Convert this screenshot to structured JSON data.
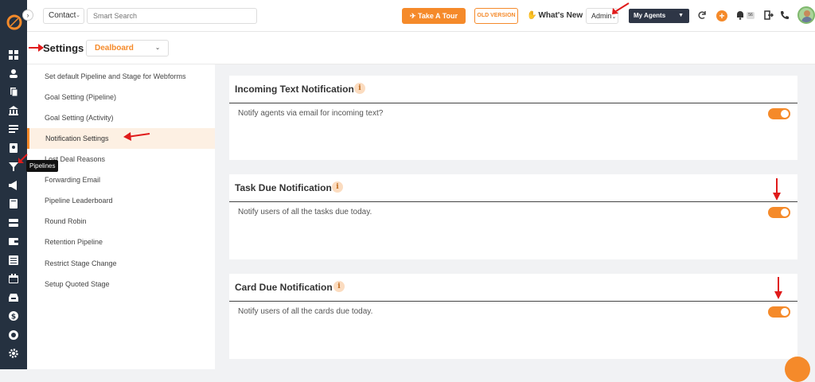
{
  "topbar": {
    "contact_select": "Contact",
    "search_placeholder": "Smart Search",
    "tour_button": "Take A Tour",
    "old_version": "OLD VERSION",
    "whats_new": "What's New",
    "admin_select": "Admin",
    "agents_select": "My Agents",
    "notification_badge": "56"
  },
  "sidebar": {
    "tooltip": "Pipelines",
    "icons": [
      "dashboard-icon",
      "contacts-icon",
      "documents-icon",
      "bank-icon",
      "list-icon",
      "profile-card-icon",
      "pipelines-icon",
      "megaphone-icon",
      "book-icon",
      "layers-icon",
      "wallet-icon",
      "table-icon",
      "calendar-icon",
      "inbox-icon",
      "dollar-icon",
      "settings-icon"
    ]
  },
  "settings": {
    "title": "Settings",
    "board_select": "Dealboard"
  },
  "menu": {
    "items": [
      "Set default Pipeline and Stage for Webforms",
      "Goal Setting (Pipeline)",
      "Goal Setting (Activity)",
      "Notification Settings",
      "Lost Deal Reasons",
      "Forwarding Email",
      "Pipeline Leaderboard",
      "Round Robin",
      "Retention Pipeline",
      "Restrict Stage Change",
      "Setup Quoted Stage"
    ],
    "active_index": 3
  },
  "cards": [
    {
      "title": "Incoming Text Notification",
      "text": "Notify agents via email for incoming text?",
      "enabled": true
    },
    {
      "title": "Task Due Notification",
      "text": "Notify users of all the tasks due today.",
      "enabled": true
    },
    {
      "title": "Card Due Notification",
      "text": "Notify users of all the cards due today.",
      "enabled": true
    }
  ],
  "colors": {
    "accent": "#f58a2a",
    "rail": "#253140",
    "annotation": "#e01b1b"
  }
}
